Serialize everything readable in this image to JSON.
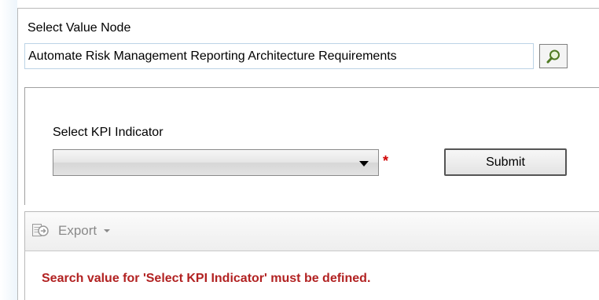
{
  "value_node": {
    "label": "Select Value Node",
    "value": "Automate Risk Management Reporting Architecture Requirements"
  },
  "kpi": {
    "label": "Select KPI Indicator",
    "selected": "",
    "required_marker": "*",
    "submit_label": "Submit"
  },
  "toolbar": {
    "export_label": "Export"
  },
  "messages": {
    "error": "Search value for 'Select KPI Indicator' must be defined."
  },
  "colors": {
    "error_text": "#b22222",
    "required": "#d00000",
    "disabled_text": "#8a8a8a",
    "input_border": "#bcd3e6"
  },
  "icons": {
    "lookup": "magnifier-icon",
    "export": "export-icon",
    "select_arrow": "chevron-down-icon",
    "export_menu": "caret-down-icon"
  }
}
